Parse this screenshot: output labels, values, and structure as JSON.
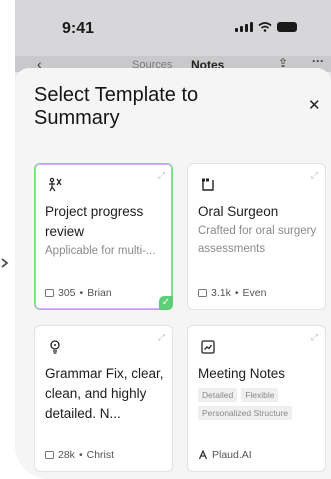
{
  "status": {
    "time": "9:41"
  },
  "nav": {
    "sources": "Sources",
    "notes": "Notes"
  },
  "sheet": {
    "title": "Select Template to Summary"
  },
  "templates": [
    {
      "name": "Project progress review",
      "desc": "Applicable for multi-...",
      "count": "305",
      "author": "Brian",
      "selected": true,
      "icon": "scissors-person-icon"
    },
    {
      "name": "Oral Surgeon",
      "desc": "Crafted for oral surgery assessments",
      "count": "3.1k",
      "author": "Even",
      "selected": false,
      "icon": "quote-icon"
    },
    {
      "name": "Grammar Fix, clear, clean, and highly detailed. N...",
      "count": "28k",
      "author": "Christ",
      "selected": false,
      "icon": "lightbulb-icon"
    },
    {
      "name": "Meeting Notes",
      "tags": [
        "Detailed",
        "Flexible",
        "Personalized Structure"
      ],
      "author": "Plaud.AI",
      "selected": false,
      "icon": "chart-icon"
    }
  ],
  "colors": {
    "selected_border": "#7fd68e",
    "check": "#5fcf79"
  }
}
